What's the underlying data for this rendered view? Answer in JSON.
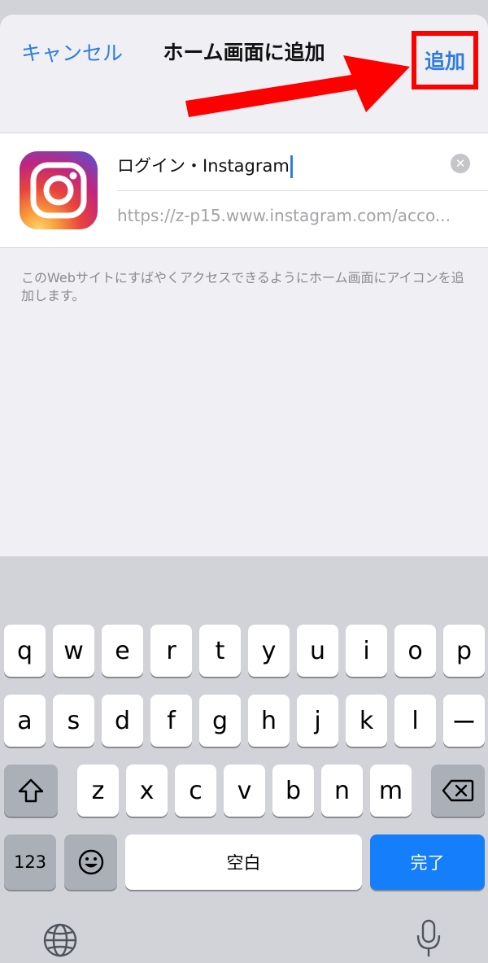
{
  "nav": {
    "cancel_label": "キャンセル",
    "title": "ホーム画面に追加",
    "add_label": "追加"
  },
  "bookmark": {
    "name_value": "ログイン・Instagram",
    "url_value": "https://z-p15.www.instagram.com/acco...",
    "clear_icon": "x-circle-icon"
  },
  "description": "このWebサイトにすばやくアクセスできるようにホーム画面にアイコンを追加します。",
  "keyboard": {
    "row1": [
      "q",
      "w",
      "e",
      "r",
      "t",
      "y",
      "u",
      "i",
      "o",
      "p"
    ],
    "row2": [
      "a",
      "s",
      "d",
      "f",
      "g",
      "h",
      "j",
      "k",
      "l",
      "ー"
    ],
    "row3": [
      "z",
      "x",
      "c",
      "v",
      "b",
      "n",
      "m"
    ],
    "numbers_label": "123",
    "space_label": "空白",
    "done_label": "完了"
  },
  "colors": {
    "accent": "#2f7de1",
    "highlight_box": "#ff0000",
    "done_key": "#147efb"
  }
}
